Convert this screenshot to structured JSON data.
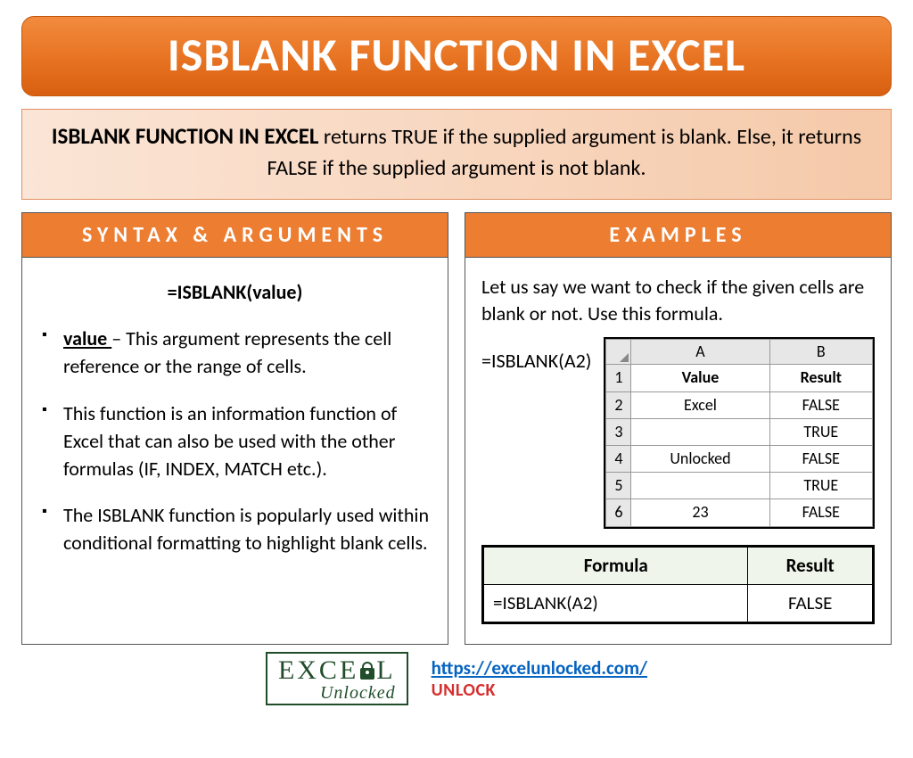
{
  "title": "ISBLANK FUNCTION IN EXCEL",
  "intro": {
    "lead": "ISBLANK FUNCTION IN EXCEL",
    "text_after_lead": " returns TRUE if the supplied argument is blank. Else, it returns FALSE if the supplied argument is not blank."
  },
  "syntax": {
    "header": "SYNTAX & ARGUMENTS",
    "formula": "=ISBLANK(value)",
    "bullets": [
      {
        "arg": "value ",
        "desc": "– This argument represents the cell reference or the range of cells."
      },
      {
        "arg": "",
        "desc": "This function is an information function of Excel that can also be used with the other formulas (IF, INDEX, MATCH etc.)."
      },
      {
        "arg": "",
        "desc": "The ISBLANK function is popularly used within conditional formatting to highlight blank cells."
      }
    ]
  },
  "examples": {
    "header": "EXAMPLES",
    "intro": "Let us say we want to check if the given cells are blank or not. Use this formula.",
    "formula": "=ISBLANK(A2)",
    "excel": {
      "columns": [
        "A",
        "B"
      ],
      "header_row": [
        "Value",
        "Result"
      ],
      "rows": [
        [
          "Excel",
          "FALSE"
        ],
        [
          "",
          "TRUE"
        ],
        [
          "Unlocked",
          "FALSE"
        ],
        [
          "",
          "TRUE"
        ],
        [
          "23",
          "FALSE"
        ]
      ]
    },
    "formula_result": {
      "headers": [
        "Formula",
        "Result"
      ],
      "row": [
        "=ISBLANK(A2)",
        "FALSE"
      ]
    }
  },
  "footer": {
    "logo_line1a": "EXCE",
    "logo_line1b": "L",
    "logo_line2": "Unlocked",
    "url": "https://excelunlocked.com/",
    "unlock": "UNLOCK"
  }
}
